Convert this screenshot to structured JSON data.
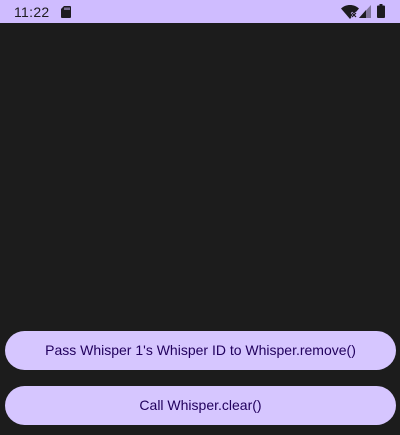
{
  "status_bar": {
    "time": "11:22",
    "icons": [
      "sd-card-icon",
      "wifi-icon",
      "cell-signal-icon",
      "battery-icon"
    ],
    "background_color": "#cfbcff"
  },
  "main": {
    "background_color": "#1c1c1c"
  },
  "buttons": {
    "remove_label": "Pass Whisper 1's Whisper ID to Whisper.remove()",
    "clear_label": "Call Whisper.clear()",
    "background_color": "#d6c6ff",
    "text_color": "#21005d"
  }
}
